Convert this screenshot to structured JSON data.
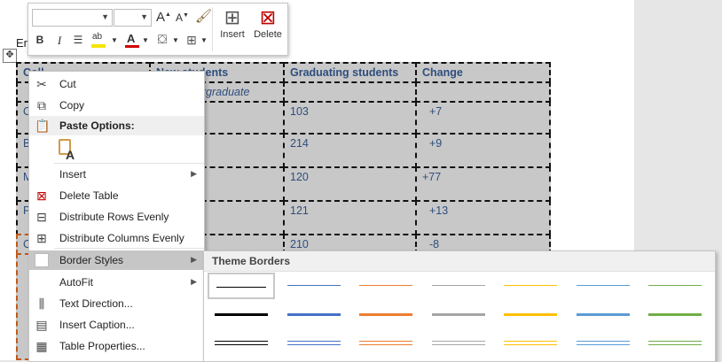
{
  "doc": {
    "partial_text": "En"
  },
  "table": {
    "headers": [
      "Coll",
      "New students",
      "Graduating students",
      "Change"
    ],
    "subheader": "Undergraduate",
    "left_fragments": [
      "C",
      "B",
      "M",
      "P",
      "C"
    ],
    "rows": [
      {
        "graduating": "103",
        "change": "+7"
      },
      {
        "graduating": "214",
        "change": "+9"
      },
      {
        "graduating": "120",
        "change": "+77"
      },
      {
        "graduating": "121",
        "change": "+13"
      },
      {
        "graduating": "210",
        "change": "-8"
      }
    ]
  },
  "mini_toolbar": {
    "font_name": "",
    "font_size": "",
    "grow_font": "A",
    "shrink_font": "A",
    "bold": "B",
    "italic": "I",
    "highlight_abbr": "ab",
    "font_color_letter": "A",
    "insert_label": "Insert",
    "delete_label": "Delete"
  },
  "context_menu": {
    "items": [
      {
        "label": "Cut",
        "icon": "scissors-icon"
      },
      {
        "label": "Copy",
        "icon": "copy-icon"
      },
      {
        "label": "Paste Options:",
        "icon": "paste-icon"
      },
      {
        "label": "Insert",
        "icon": ""
      },
      {
        "label": "Delete Table",
        "icon": "delete-table-icon"
      },
      {
        "label": "Distribute Rows Evenly",
        "icon": "distribute-rows-icon"
      },
      {
        "label": "Distribute Columns Evenly",
        "icon": "distribute-columns-icon"
      },
      {
        "label": "Border Styles",
        "icon": "border-styles-icon"
      },
      {
        "label": "AutoFit",
        "icon": ""
      },
      {
        "label": "Text Direction...",
        "icon": "text-direction-icon"
      },
      {
        "label": "Insert Caption...",
        "icon": "insert-caption-icon"
      },
      {
        "label": "Table Properties...",
        "icon": "table-properties-icon"
      }
    ],
    "paste_keep_text_letter": "A"
  },
  "border_styles": {
    "title": "Theme Borders",
    "colors": [
      "#000000",
      "#4472c4",
      "#ed7d31",
      "#a5a5a5",
      "#ffc000",
      "#5b9bd5",
      "#70ad47"
    ]
  }
}
